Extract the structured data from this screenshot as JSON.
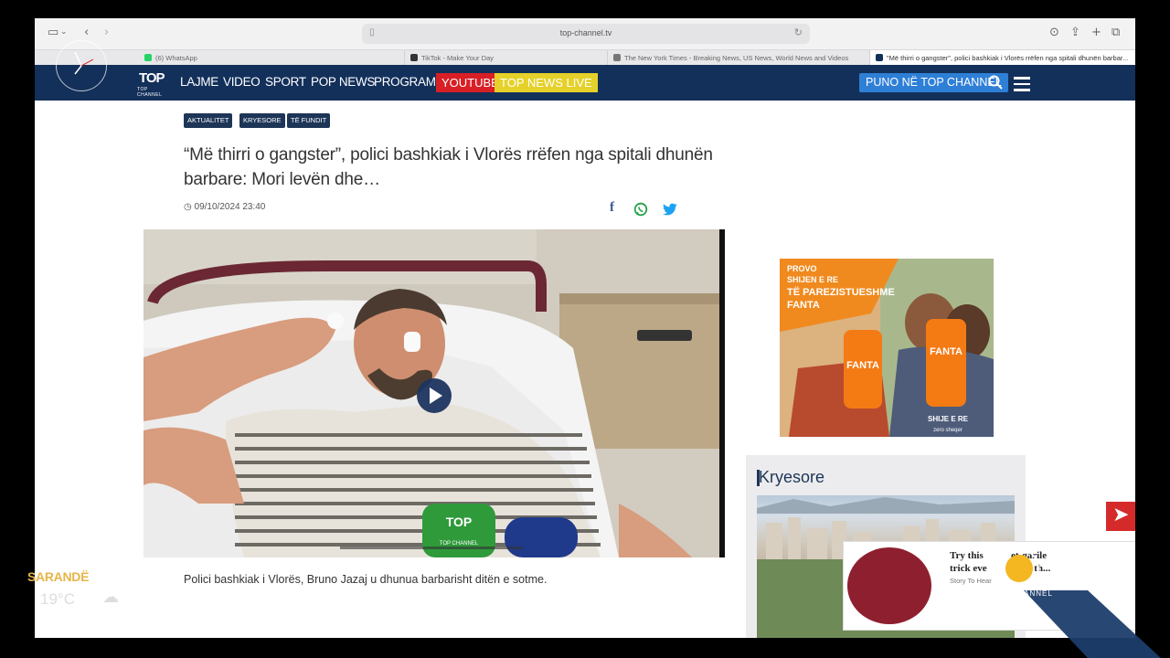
{
  "browser": {
    "url": "top-channel.tv",
    "tabs": [
      {
        "label": "(6) WhatsApp",
        "color": "#25d366"
      },
      {
        "label": "TikTok - Make Your Day",
        "color": "#333333"
      },
      {
        "label": "The New York Times - Breaking News, US News, World News and Videos",
        "color": "#555555"
      },
      {
        "label": "\"Më thirri o gangster\", polici bashkiak i Vlorës rrëfen nga spitali dhunën barbar...",
        "color": "#13305a",
        "active": true
      }
    ]
  },
  "nav": {
    "logo_top": "TOP",
    "logo_sub": "TOP CHANNEL",
    "items": [
      "LAJME",
      "VIDEO",
      "SPORT",
      "POP NEWS",
      "PROGRAME"
    ],
    "youtube": "YOUTUBE",
    "live": "TOP NEWS LIVE",
    "puno": "PUNO NË TOP CHANNEL"
  },
  "article": {
    "tags": [
      "AKTUALITET",
      "KRYESORE",
      "TË FUNDIT"
    ],
    "headline": "“Më thirri o gangster”, polici bashkiak i Vlorës rrëfen nga spitali dhunën barbare: Mori levën dhe…",
    "date": "09/10/2024 23:40",
    "share": {
      "facebook": "f",
      "whatsapp": "whatsapp",
      "twitter": "twitter"
    },
    "caption": "Polici bashkiak i Vlorës, Bruno Jazaj u dhunua barbarisht ditën e sotme.",
    "mic_label": "TOP CHANNEL"
  },
  "ad": {
    "line1": "PROVO",
    "line2": "SHIJEN E RE",
    "line3": "TË PAREZISTUESHME",
    "line4": "FANTA",
    "can_left": "FANTA",
    "can_right": "FANTA",
    "badge": "SHIJE E RE",
    "badge_sub": "zero sheqer"
  },
  "sidebar": {
    "title": "Kryesore"
  },
  "popup": {
    "title_a": "Try this",
    "title_b": "et-garile",
    "title_c": "trick eve",
    "title_d": "e th...",
    "source": "Story To Hear",
    "logo_text": "TOP CHANNEL"
  },
  "overlay": {
    "city": "SARANDË",
    "temp": "19°C"
  }
}
